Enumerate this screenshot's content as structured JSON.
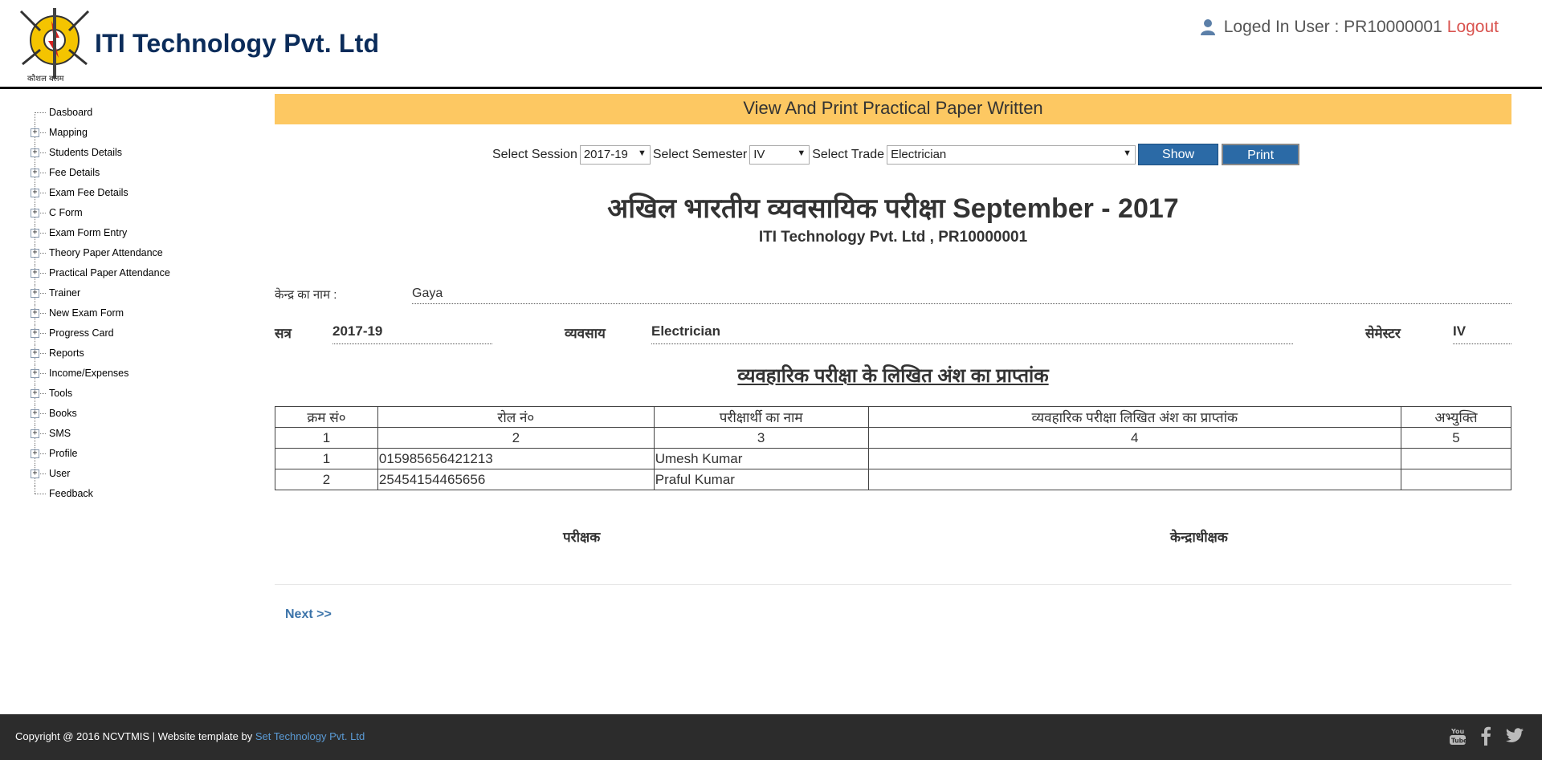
{
  "header": {
    "brand": "ITI Technology Pvt. Ltd",
    "logo_text": "कौशल बलम",
    "user_label": "Loged In User : PR10000001",
    "logout_label": "Logout"
  },
  "sidebar": {
    "items": [
      {
        "label": "Dasboard",
        "expandable": false
      },
      {
        "label": "Mapping",
        "expandable": true
      },
      {
        "label": "Students Details",
        "expandable": true
      },
      {
        "label": "Fee Details",
        "expandable": true
      },
      {
        "label": "Exam Fee Details",
        "expandable": true
      },
      {
        "label": "C Form",
        "expandable": true
      },
      {
        "label": "Exam Form Entry",
        "expandable": true
      },
      {
        "label": "Theory Paper Attendance",
        "expandable": true
      },
      {
        "label": "Practical Paper Attendance",
        "expandable": true
      },
      {
        "label": "Trainer",
        "expandable": true
      },
      {
        "label": "New Exam Form",
        "expandable": true
      },
      {
        "label": "Progress Card",
        "expandable": true
      },
      {
        "label": "Reports",
        "expandable": true
      },
      {
        "label": "Income/Expenses",
        "expandable": true
      },
      {
        "label": "Tools",
        "expandable": true
      },
      {
        "label": "Books",
        "expandable": true
      },
      {
        "label": "SMS",
        "expandable": true
      },
      {
        "label": "Profile",
        "expandable": true
      },
      {
        "label": "User",
        "expandable": true
      },
      {
        "label": "Feedback",
        "expandable": false
      }
    ]
  },
  "page": {
    "title": "View And Print Practical Paper Written"
  },
  "filters": {
    "session_label": "Select Session",
    "session_value": "2017-19",
    "semester_label": "Select Semester",
    "semester_value": "IV",
    "trade_label": "Select Trade",
    "trade_value": "Electrician",
    "show_label": "Show",
    "print_label": "Print"
  },
  "report": {
    "exam_title": "अखिल भारतीय व्यवसायिक परीक्षा September - 2017",
    "org_line": "ITI Technology Pvt. Ltd , PR10000001",
    "center_label": "केन्द्र का नाम :",
    "center_value": "Gaya",
    "session_label": "सत्र",
    "session_value": "2017-19",
    "trade_label": "व्यवसाय",
    "trade_value": "Electrician",
    "semester_label": "सेमेस्टर",
    "semester_value": "IV",
    "sub_title": "व्यवहारिक परीक्षा के लिखित अंश का प्राप्तांक",
    "columns": [
      "क्रम सं०",
      "रोल नं०",
      "परीक्षार्थी का नाम",
      "व्यवहारिक परीक्षा लिखित अंश का प्राप्तांक",
      "अभ्युक्ति"
    ],
    "column_numbers": [
      "1",
      "2",
      "3",
      "4",
      "5"
    ],
    "rows": [
      {
        "sno": "1",
        "roll": "015985656421213",
        "name": "Umesh Kumar",
        "marks": "",
        "remarks": ""
      },
      {
        "sno": "2",
        "roll": "25454154465656",
        "name": "Praful Kumar",
        "marks": "",
        "remarks": ""
      }
    ],
    "examiner_label": "परीक्षक",
    "superintendent_label": "केन्द्राधीक्षक",
    "next_label": "Next >>"
  },
  "footer": {
    "copyright": "Copyright @ 2016 NCVTMIS | Website template by ",
    "template_link": "Set Technology Pvt. Ltd",
    "social_icons": [
      "youtube-icon",
      "facebook-icon",
      "twitter-icon"
    ]
  },
  "colors": {
    "title_bar": "#fdc862",
    "button": "#2b6aa6",
    "brand": "#0b2c5a",
    "logout": "#d9534f",
    "footer": "#2c2c2c",
    "link": "#3b73a9"
  }
}
